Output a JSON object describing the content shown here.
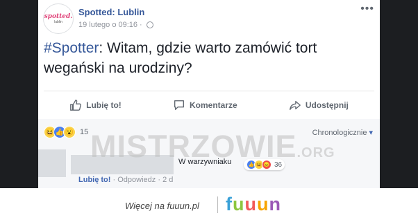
{
  "post": {
    "page_name": "Spotted: Lublin",
    "avatar_logo_top": "spotted.",
    "avatar_logo_bottom": "lublin",
    "timestamp": "19 lutego o 09:16",
    "meta_separator": "·",
    "more_icon": "ellipsis-icon",
    "hashtag": "#Spotter",
    "text": ": Witam, gdzie warto zamówić tort wegański na urodziny?"
  },
  "actions": {
    "like_label": "Lubię to!",
    "comment_label": "Komentarze",
    "share_label": "Udostępnij"
  },
  "reactions": {
    "icons": [
      "haha-icon",
      "like-icon",
      "wow-icon"
    ],
    "count": "15",
    "sort_label": "Chronologicznie",
    "sort_caret": "▾"
  },
  "comment": {
    "text_visible": "W warzywniaku",
    "reaction_count": "36",
    "like_label": "Lubię to!",
    "separator": "·",
    "reply_label": "Odpowiedz",
    "time": "2 d"
  },
  "watermark": {
    "text": "MISTRZOWIE",
    "suffix": ".ORG"
  },
  "footer": {
    "text": "Więcej na fuuun.pl",
    "logo_letters": [
      "f",
      "u",
      "u",
      "u",
      "n"
    ]
  },
  "colors": {
    "link": "#365899",
    "like_blue": "#4267b2",
    "muted": "#90949c",
    "page_bg": "#1c1e21"
  }
}
